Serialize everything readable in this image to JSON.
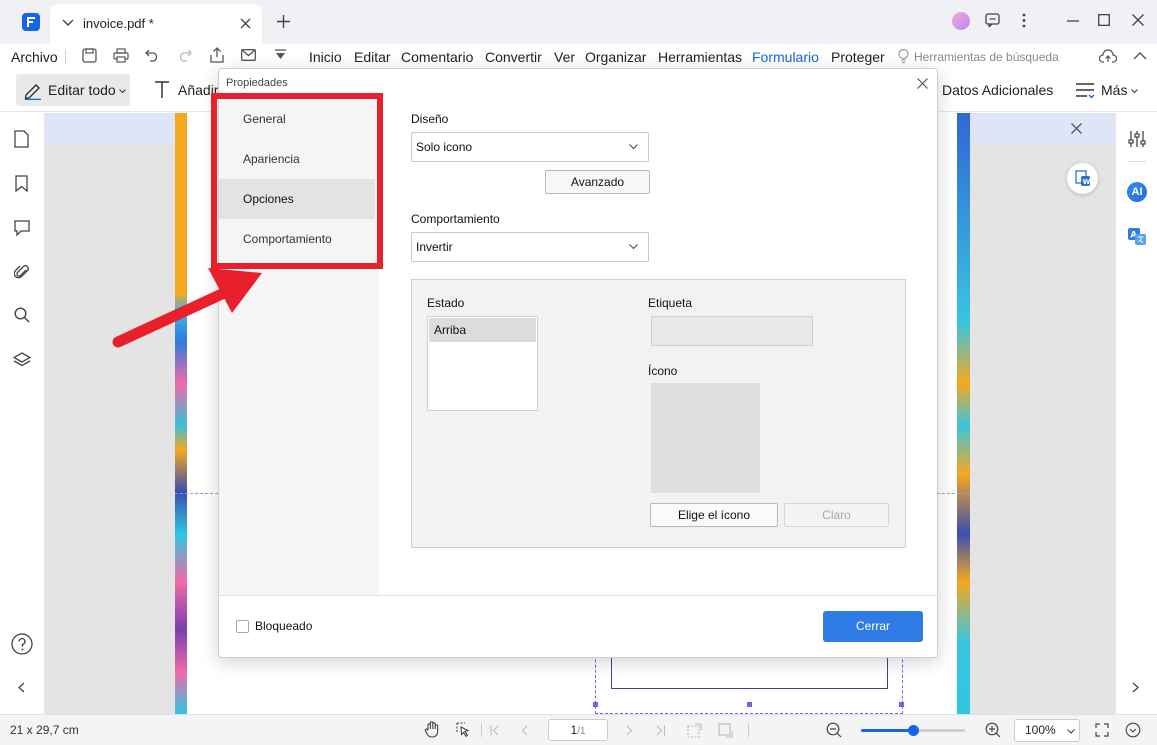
{
  "app": {
    "tab_title": "invoice.pdf *",
    "brand_color": "#1565e8"
  },
  "menubar": {
    "file": "Archivo",
    "items": [
      "Inicio",
      "Editar",
      "Comentario",
      "Convertir",
      "Ver",
      "Organizar",
      "Herramientas",
      "Formulario",
      "Proteger"
    ],
    "active_item": "Formulario",
    "search_tools": "Herramientas de búsqueda"
  },
  "toolbar": {
    "edit_all": "Editar todo",
    "add_text": "Añadir",
    "additional_data": "Datos Adicionales",
    "more": "Más"
  },
  "right_panel": {
    "ai_label": "AI"
  },
  "statusbar": {
    "page_size": "21 x 29,7 cm",
    "current_page": "1",
    "total_pages": "/1",
    "zoom": "100%",
    "zoom_slider_fraction": 0.5
  },
  "dialog": {
    "title": "Propiedades",
    "sidebar": [
      "General",
      "Apariencia",
      "Opciones",
      "Comportamiento"
    ],
    "active_tab": "Opciones",
    "layout_label": "Diseño",
    "layout_value": "Solo icono",
    "advanced_button": "Avanzado",
    "behavior_label": "Comportamiento",
    "behavior_value": "Invertir",
    "state_label": "Estado",
    "state_items": [
      "Arriba"
    ],
    "caption_label": "Etiqueta",
    "caption_value": "",
    "icon_label": "Ícono",
    "choose_icon_button": "Elige el ícono",
    "clear_button": "Claro",
    "locked_label": "Bloqueado",
    "close_button": "Cerrar"
  }
}
